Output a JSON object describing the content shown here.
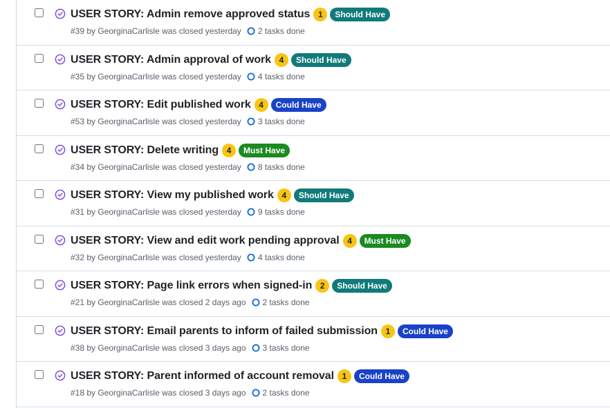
{
  "colors": {
    "status_closed": "#8250df",
    "task_ring": "#0969da",
    "count_badge": "#f9c513",
    "should_have": "#117a7a",
    "could_have": "#1a42c9",
    "must_have": "#1a8a21"
  },
  "icons": {
    "status": "issue-closed-check-icon",
    "tasks": "task-progress-ring-icon"
  },
  "issues": [
    {
      "title": "USER STORY: Admin remove approved status",
      "count": "1",
      "label": "Should Have",
      "label_color": "#117a7a",
      "number": "#39",
      "by": " by ",
      "author": "GeorginaCarlisle",
      "closed": " was closed yesterday",
      "tasks": "2 tasks done"
    },
    {
      "title": "USER STORY: Admin approval of work",
      "count": "4",
      "label": "Should Have",
      "label_color": "#117a7a",
      "number": "#35",
      "by": " by ",
      "author": "GeorginaCarlisle",
      "closed": " was closed yesterday",
      "tasks": "4 tasks done"
    },
    {
      "title": "USER STORY: Edit published work",
      "count": "4",
      "label": "Could Have",
      "label_color": "#1a42c9",
      "number": "#53",
      "by": " by ",
      "author": "GeorginaCarlisle",
      "closed": " was closed yesterday",
      "tasks": "3 tasks done"
    },
    {
      "title": "USER STORY: Delete writing",
      "count": "4",
      "label": "Must Have",
      "label_color": "#1a8a21",
      "number": "#34",
      "by": " by ",
      "author": "GeorginaCarlisle",
      "closed": " was closed yesterday",
      "tasks": "8 tasks done"
    },
    {
      "title": "USER STORY: View my published work",
      "count": "4",
      "label": "Should Have",
      "label_color": "#117a7a",
      "number": "#31",
      "by": " by ",
      "author": "GeorginaCarlisle",
      "closed": " was closed yesterday",
      "tasks": "9 tasks done"
    },
    {
      "title": "USER STORY: View and edit work pending approval",
      "count": "4",
      "label": "Must Have",
      "label_color": "#1a8a21",
      "number": "#32",
      "by": " by ",
      "author": "GeorginaCarlisle",
      "closed": " was closed yesterday",
      "tasks": "4 tasks done"
    },
    {
      "title": "USER STORY: Page link errors when signed-in",
      "count": "2",
      "label": "Should Have",
      "label_color": "#117a7a",
      "number": "#21",
      "by": " by ",
      "author": "GeorginaCarlisle",
      "closed": " was closed 2 days ago",
      "tasks": "2 tasks done"
    },
    {
      "title": "USER STORY: Email parents to inform of failed submission",
      "count": "1",
      "label": "Could Have",
      "label_color": "#1a42c9",
      "number": "#38",
      "by": " by ",
      "author": "GeorginaCarlisle",
      "closed": " was closed 3 days ago",
      "tasks": "3 tasks done"
    },
    {
      "title": "USER STORY: Parent informed of account removal",
      "count": "1",
      "label": "Could Have",
      "label_color": "#1a42c9",
      "number": "#18",
      "by": " by ",
      "author": "GeorginaCarlisle",
      "closed": " was closed 3 days ago",
      "tasks": "2 tasks done"
    }
  ]
}
